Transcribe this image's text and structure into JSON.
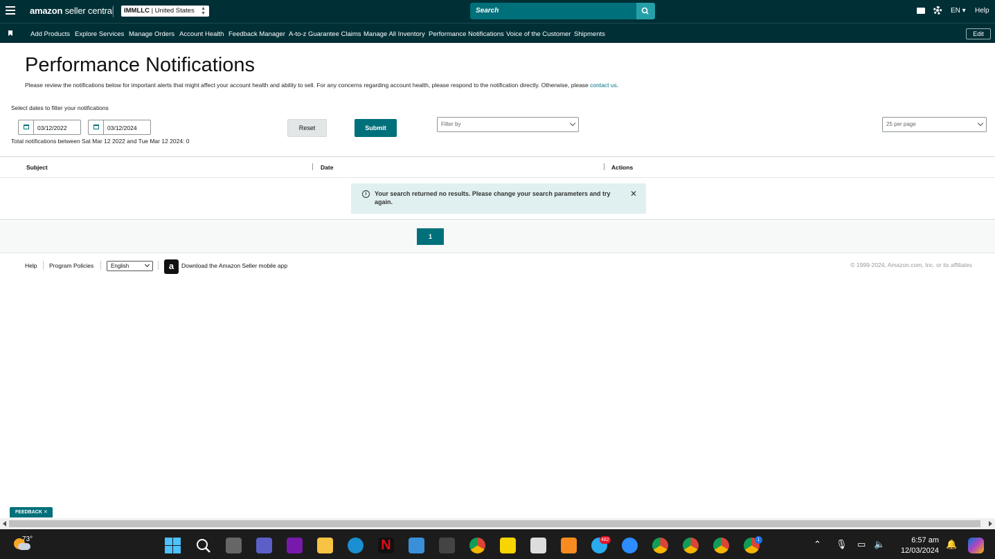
{
  "header": {
    "logo_bold": "amazon",
    "logo_thin": " seller central",
    "account_name": "IMMLLC",
    "account_region": " | United States",
    "search_placeholder": "Search",
    "language": "EN ▾",
    "help": "Help"
  },
  "nav": {
    "items": [
      "Add Products",
      "Explore Services",
      "Manage Orders",
      "Account Health",
      "Feedback Manager",
      "A-to-z Guarantee Claims",
      "Manage All Inventory",
      "Performance Notifications",
      "Voice of the Customer",
      "Shipments"
    ],
    "edit": "Edit"
  },
  "page": {
    "title": "Performance Notifications",
    "intro": "Please review the notifications below for important alerts that might affect your account health and ability to sell. For any concerns regarding account health, please respond to the notification directly. Otherwise, please ",
    "contact_link": "contact us",
    "intro_end": ".",
    "filter_label": "Select dates to filter your notifications",
    "start_date": "03/12/2022",
    "end_date": "03/12/2024",
    "reset": "Reset",
    "submit": "Submit",
    "filter_by_placeholder": "Filter by",
    "per_page": "25 per page",
    "total": "Total notifications between Sat Mar 12 2022 and Tue Mar 12 2024: 0"
  },
  "table": {
    "columns": [
      "Subject",
      "Date",
      "Actions"
    ],
    "no_results": "Your search returned no results. Please change your search parameters and try again."
  },
  "pagination": {
    "current": "1"
  },
  "footer": {
    "help": "Help",
    "program_policies": "Program Policies",
    "language": "English",
    "app_link": "Download the Amazon Seller mobile app",
    "copyright": "© 1999-2024, Amazon.com, Inc. or its affiliates"
  },
  "feedback": "FEEDBACK ✕",
  "taskbar": {
    "temperature": "73°",
    "telegram_badge": "482",
    "chrome_badge": "1",
    "time": "6:57 am",
    "date": "12/03/2024"
  }
}
